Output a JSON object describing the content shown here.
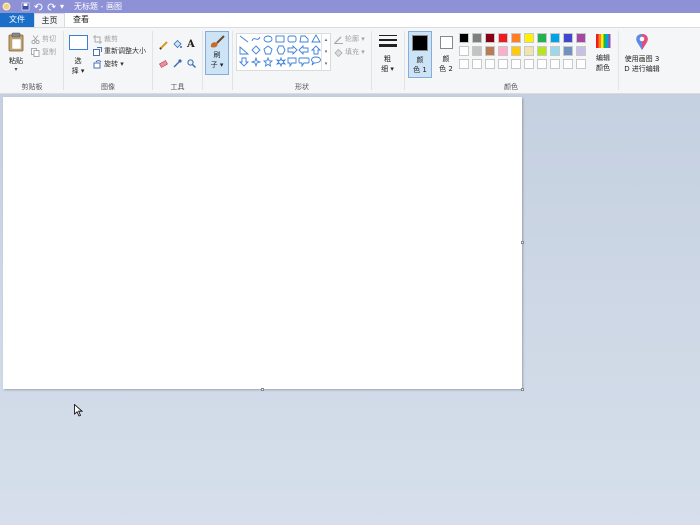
{
  "window": {
    "title": "无标题 - 画图",
    "quick_access_down": "▾"
  },
  "tabs": {
    "file": "文件",
    "home": "主页",
    "view": "查看"
  },
  "clipboard": {
    "paste": "粘贴",
    "paste_arrow": "▾",
    "cut": "剪切",
    "copy": "复制",
    "group": "剪贴板"
  },
  "image": {
    "select_line1": "选",
    "select_line2": "择 ▾",
    "crop": "裁剪",
    "resize": "重新调整大小",
    "rotate": "旋转 ▾",
    "group": "图像"
  },
  "tools": {
    "group": "工具",
    "text_glyph": "A"
  },
  "brushes": {
    "line1": "刷",
    "line2": "子 ▾"
  },
  "shapes": {
    "outline": "轮廓 ▾",
    "fill": "填充 ▾",
    "group": "形状"
  },
  "size": {
    "line1": "粗",
    "line2": "细 ▾"
  },
  "colors": {
    "color1_line1": "颜",
    "color1_line2": "色 1",
    "color2_line1": "颜",
    "color2_line2": "色 2",
    "edit_line1": "编辑",
    "edit_line2": "颜色",
    "group": "颜色",
    "color1_value": "#000000",
    "color2_value": "#ffffff",
    "palette_row1": [
      "#000000",
      "#7f7f7f",
      "#880015",
      "#ed1c24",
      "#ff7f27",
      "#fff200",
      "#22b14c",
      "#00a2e8",
      "#3f48cc",
      "#a349a4"
    ],
    "palette_row2": [
      "#ffffff",
      "#c3c3c3",
      "#b97a57",
      "#ffaec9",
      "#ffc90e",
      "#efe4b0",
      "#b5e61d",
      "#99d9ea",
      "#7092be",
      "#c8bfe7"
    ]
  },
  "paint3d": {
    "line1": "使用画图 3",
    "line2": "D 进行编辑"
  }
}
